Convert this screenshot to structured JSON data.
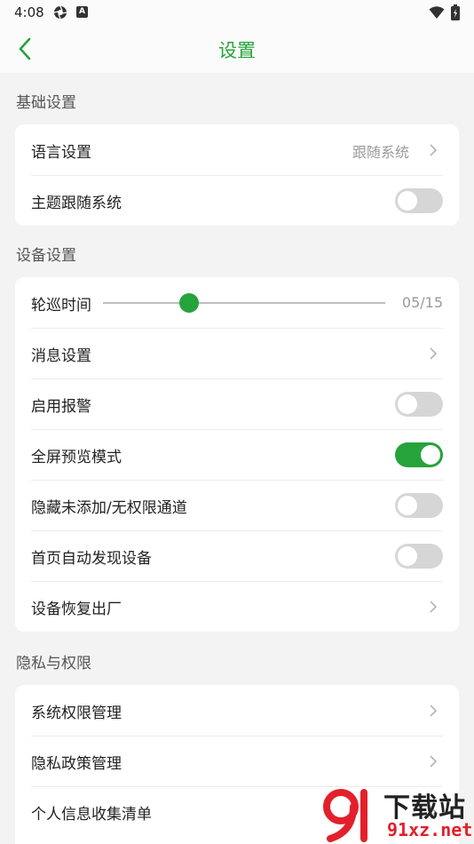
{
  "status_bar": {
    "time": "4:08",
    "badge_letter": "A"
  },
  "header": {
    "title": "设置"
  },
  "sections": {
    "basic": {
      "title": "基础设置",
      "language": {
        "label": "语言设置",
        "value": "跟随系统"
      },
      "theme": {
        "label": "主题跟随系统",
        "on": false
      }
    },
    "device": {
      "title": "设备设置",
      "patrol": {
        "label": "轮巡时间",
        "value_text": "05/15",
        "value": 5,
        "max": 15
      },
      "message": {
        "label": "消息设置"
      },
      "alarm": {
        "label": "启用报警",
        "on": false
      },
      "fullscreen": {
        "label": "全屏预览模式",
        "on": true
      },
      "hide_channels": {
        "label": "隐藏未添加/无权限通道",
        "on": false
      },
      "auto_discover": {
        "label": "首页自动发现设备",
        "on": false
      },
      "factory_reset": {
        "label": "设备恢复出厂"
      }
    },
    "privacy": {
      "title": "隐私与权限",
      "system_permissions": {
        "label": "系统权限管理"
      },
      "privacy_policy": {
        "label": "隐私政策管理"
      },
      "personal_info": {
        "label": "个人信息收集清单"
      }
    }
  },
  "watermark": {
    "brand_cn": "下载站",
    "url": "91xz.net"
  },
  "colors": {
    "accent": "#27a33c",
    "toggle_off": "#d6d6d6",
    "background": "#f3f3f3"
  }
}
